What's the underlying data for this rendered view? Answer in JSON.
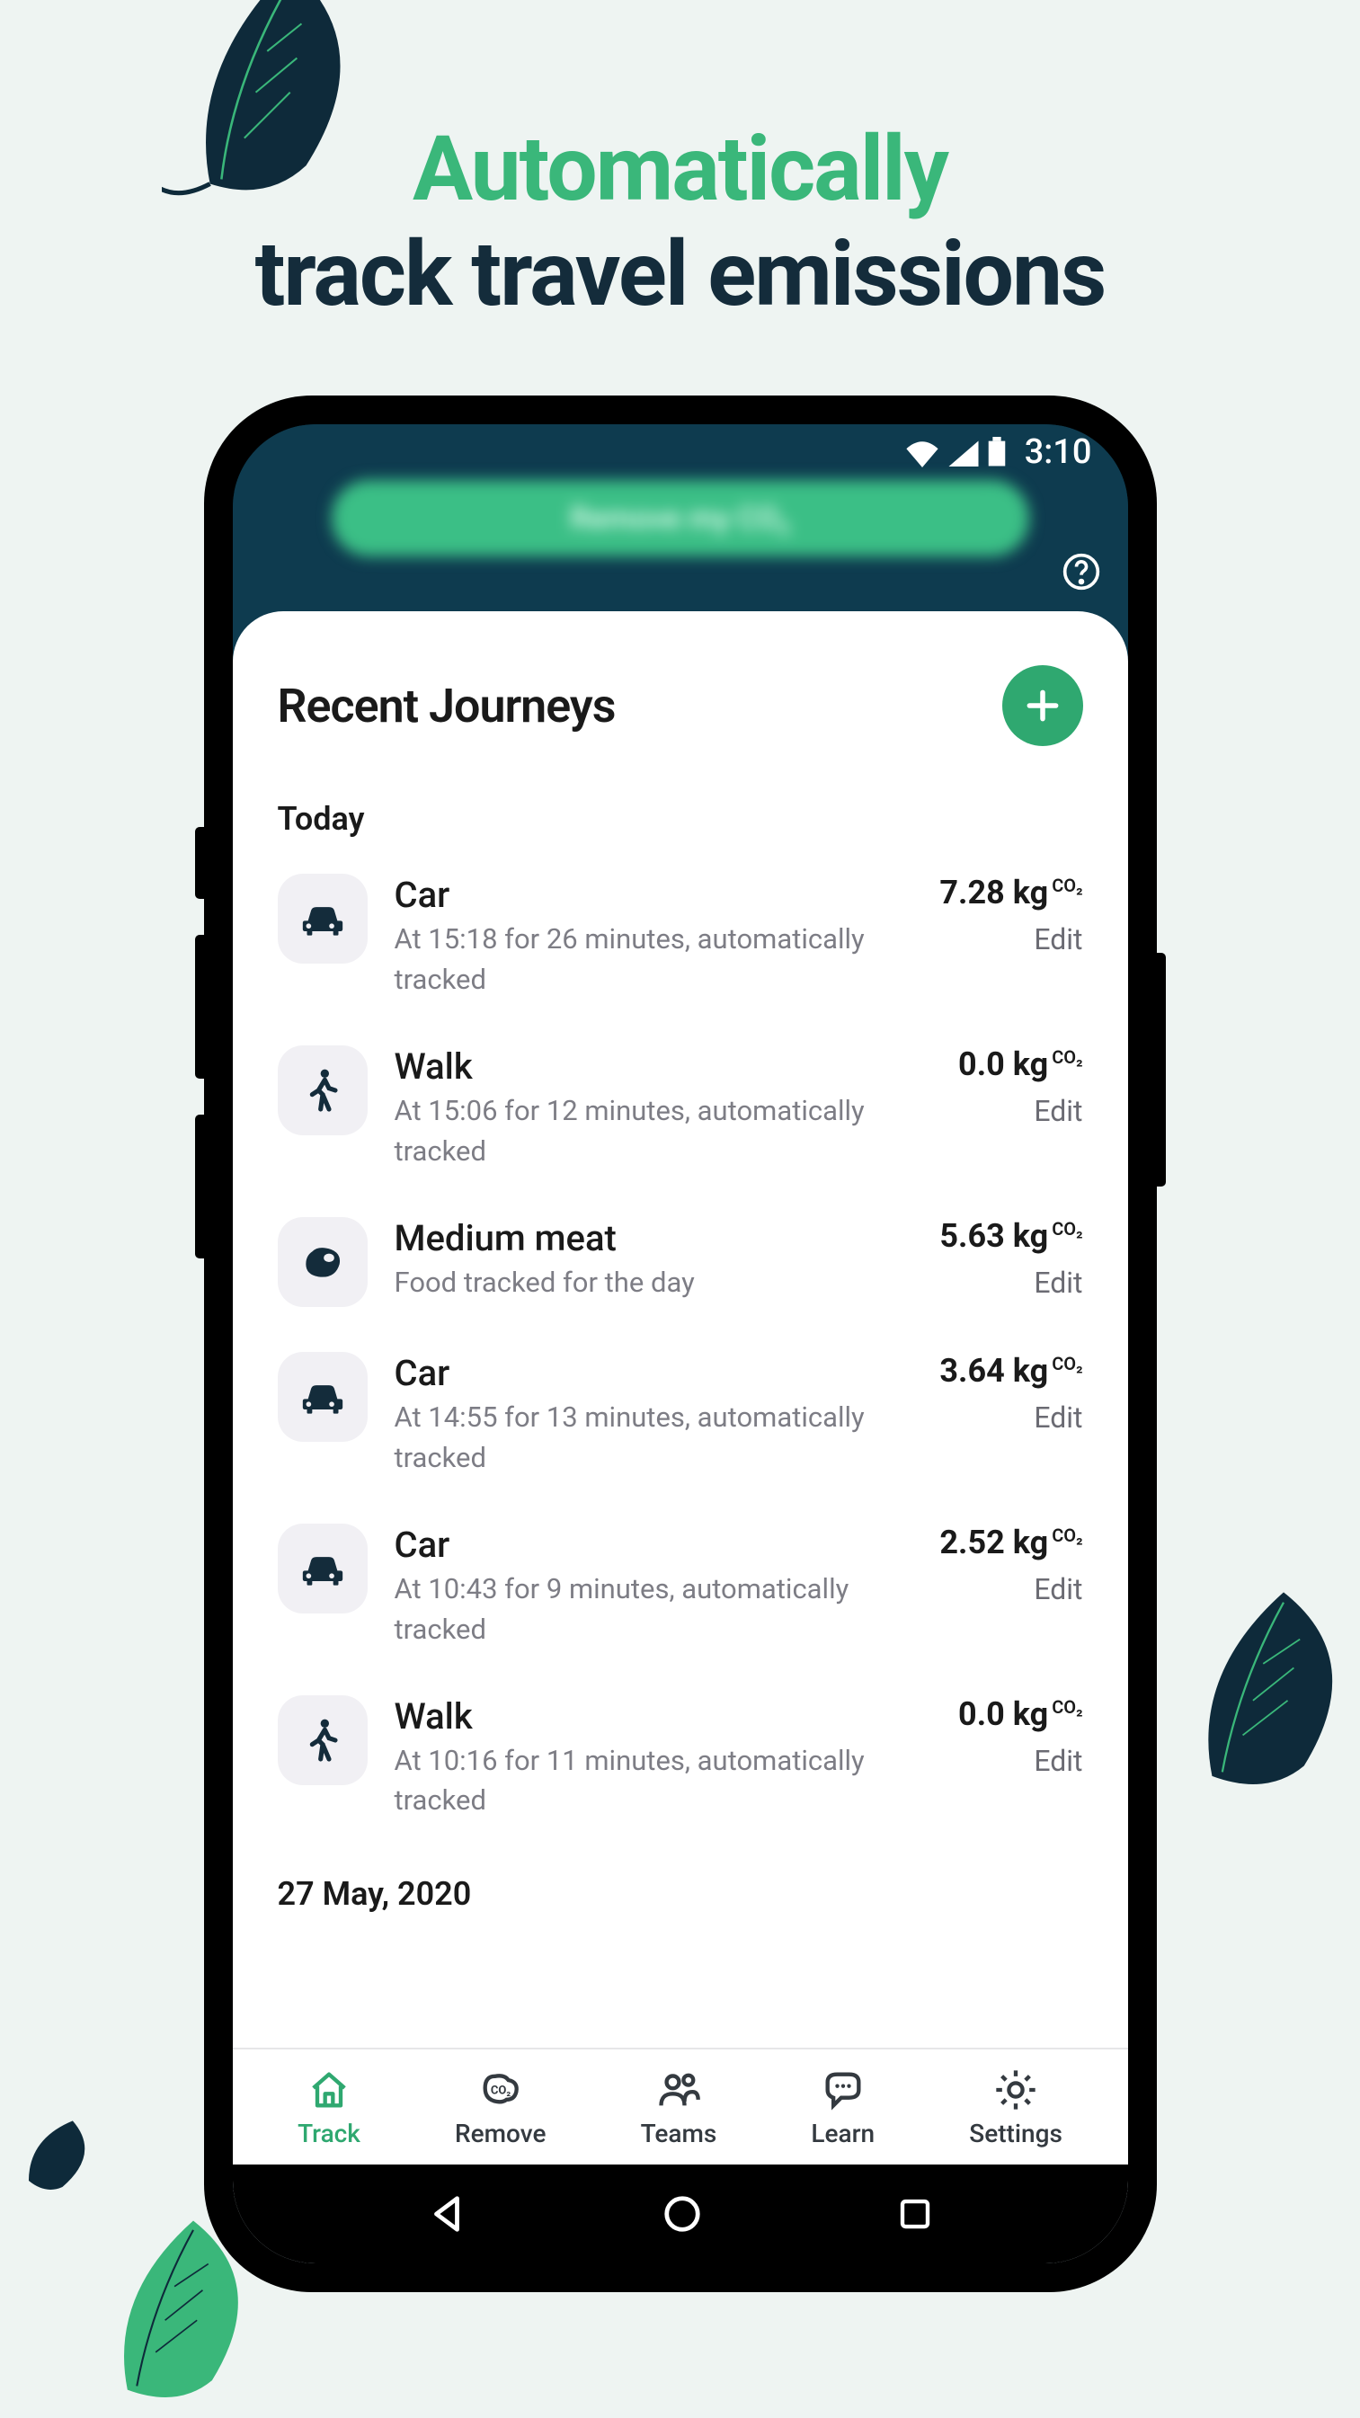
{
  "headline": {
    "line1": "Automatically",
    "line2": "track travel emissions"
  },
  "status": {
    "time": "3:10"
  },
  "header": {
    "pill_label": "Remove my CO₂"
  },
  "section": {
    "title": "Recent Journeys",
    "day_label": "Today",
    "prev_day": "27 May, 2020"
  },
  "journeys": [
    {
      "type": "car",
      "title": "Car",
      "sub": "At 15:18 for 26 minutes, automatically tracked",
      "amount": "7.28 kg",
      "unit": "CO₂",
      "edit": "Edit"
    },
    {
      "type": "walk",
      "title": "Walk",
      "sub": "At 15:06 for 12 minutes, automatically tracked",
      "amount": "0.0 kg",
      "unit": "CO₂",
      "edit": "Edit"
    },
    {
      "type": "meat",
      "title": "Medium meat",
      "sub": "Food tracked for the day",
      "amount": "5.63 kg",
      "unit": "CO₂",
      "edit": "Edit"
    },
    {
      "type": "car",
      "title": "Car",
      "sub": "At 14:55 for 13 minutes, automatically tracked",
      "amount": "3.64 kg",
      "unit": "CO₂",
      "edit": "Edit"
    },
    {
      "type": "car",
      "title": "Car",
      "sub": "At 10:43 for 9 minutes, automatically tracked",
      "amount": "2.52 kg",
      "unit": "CO₂",
      "edit": "Edit"
    },
    {
      "type": "walk",
      "title": "Walk",
      "sub": "At 10:16 for 11 minutes, automatically tracked",
      "amount": "0.0 kg",
      "unit": "CO₂",
      "edit": "Edit"
    }
  ],
  "nav": {
    "items": [
      {
        "label": "Track",
        "icon": "home",
        "active": true
      },
      {
        "label": "Remove",
        "icon": "co2",
        "active": false
      },
      {
        "label": "Teams",
        "icon": "people",
        "active": false
      },
      {
        "label": "Learn",
        "icon": "chat",
        "active": false
      },
      {
        "label": "Settings",
        "icon": "gear",
        "active": false
      }
    ]
  }
}
